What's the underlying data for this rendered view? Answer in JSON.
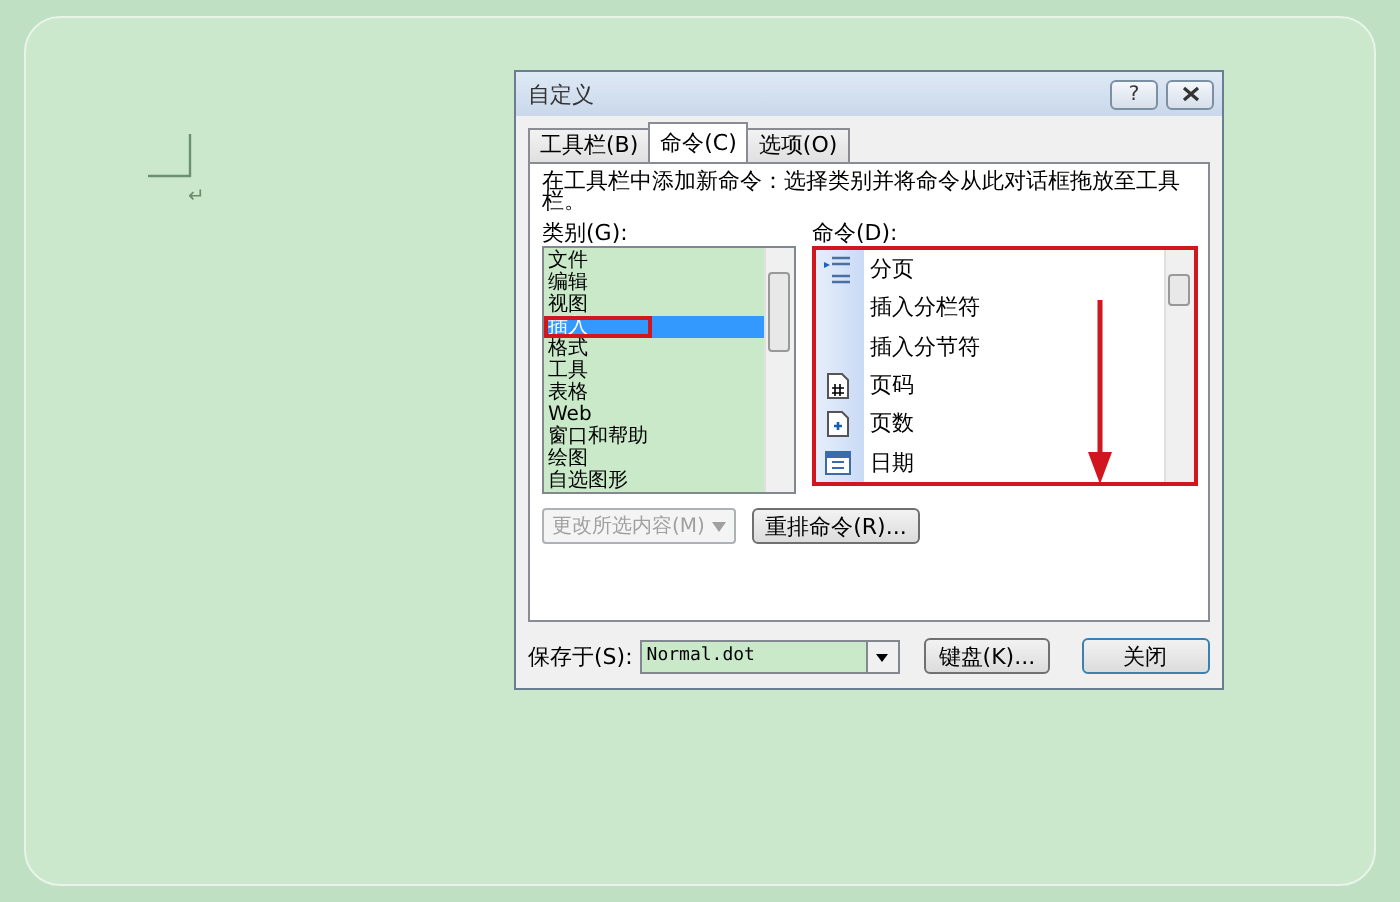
{
  "document": {
    "paragraph_mark": "↵"
  },
  "dialog": {
    "title": "自定义",
    "help_button": "?",
    "tabs": [
      {
        "label": "工具栏(B)",
        "selected": false
      },
      {
        "label": "命令(C)",
        "selected": true
      },
      {
        "label": "选项(O)",
        "selected": false
      }
    ],
    "description": "在工具栏中添加新命令：选择类别并将命令从此对话框拖放至工具栏。",
    "categories_label": "类别(G):",
    "categories": [
      {
        "label": "文件",
        "selected": false
      },
      {
        "label": "编辑",
        "selected": false
      },
      {
        "label": "视图",
        "selected": false
      },
      {
        "label": "插入",
        "selected": true
      },
      {
        "label": "格式",
        "selected": false
      },
      {
        "label": "工具",
        "selected": false
      },
      {
        "label": "表格",
        "selected": false
      },
      {
        "label": "Web",
        "selected": false
      },
      {
        "label": "窗口和帮助",
        "selected": false
      },
      {
        "label": "绘图",
        "selected": false
      },
      {
        "label": "自选图形",
        "selected": false
      }
    ],
    "commands_label": "命令(D):",
    "commands": [
      {
        "label": "分页",
        "kind": "break"
      },
      {
        "label": "插入分栏符",
        "kind": "plain"
      },
      {
        "label": "插入分节符",
        "kind": "plain"
      },
      {
        "label": "页码",
        "kind": "page-number"
      },
      {
        "label": "页数",
        "kind": "page-count"
      },
      {
        "label": "日期",
        "kind": "date"
      }
    ],
    "modify_button": {
      "label": "更改所选内容(M)",
      "disabled": true
    },
    "rearrange_button": "重排命令(R)...",
    "save_in_label": "保存于(S):",
    "save_in_value": "Normal.dot",
    "keyboard_button": "键盘(K)...",
    "close_button": "关闭"
  }
}
